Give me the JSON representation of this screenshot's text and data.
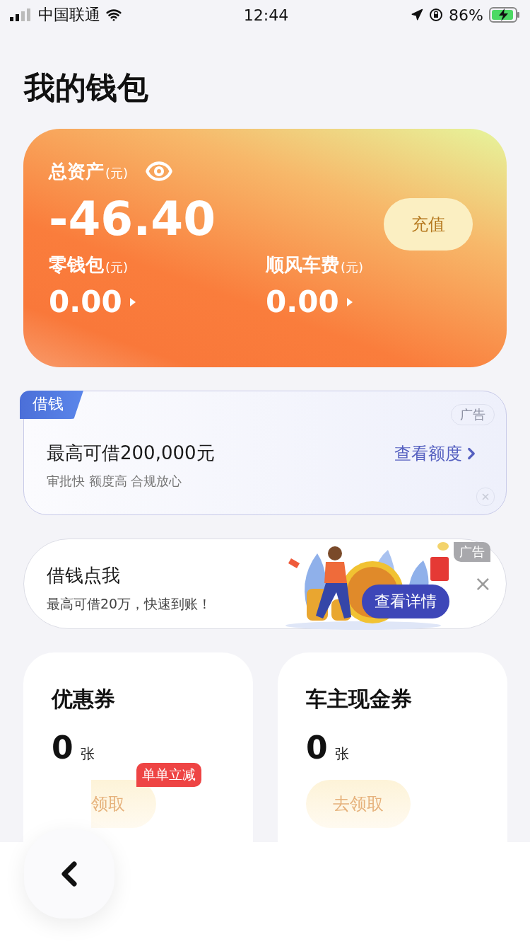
{
  "status_bar": {
    "carrier": "中国联通",
    "time": "12:44",
    "battery": "86%"
  },
  "title": "我的钱包",
  "wallet": {
    "total_label": "总资产",
    "total_unit": "(元)",
    "total": "-46.40",
    "recharge": "充值",
    "sub": [
      {
        "label": "零钱包",
        "unit": "(元)",
        "value": "0.00"
      },
      {
        "label": "顺风车费",
        "unit": "(元)",
        "value": "0.00"
      }
    ]
  },
  "loan_card": {
    "tag": "借钱",
    "ad": "广告",
    "headline": "最高可借200,000元",
    "subtitle": "审批快 额度高 合规放心",
    "link": "查看额度"
  },
  "ad_banner": {
    "title": "借钱点我",
    "subtitle": "最高可借20万，快速到账！",
    "button": "查看详情",
    "ad": "广告",
    "close": "×"
  },
  "coupons": [
    {
      "title": "优惠券",
      "count": "0",
      "unit": "张",
      "button": "领取",
      "badge": "单单立减"
    },
    {
      "title": "车主现金券",
      "count": "0",
      "unit": "张",
      "button": "去领取"
    }
  ]
}
